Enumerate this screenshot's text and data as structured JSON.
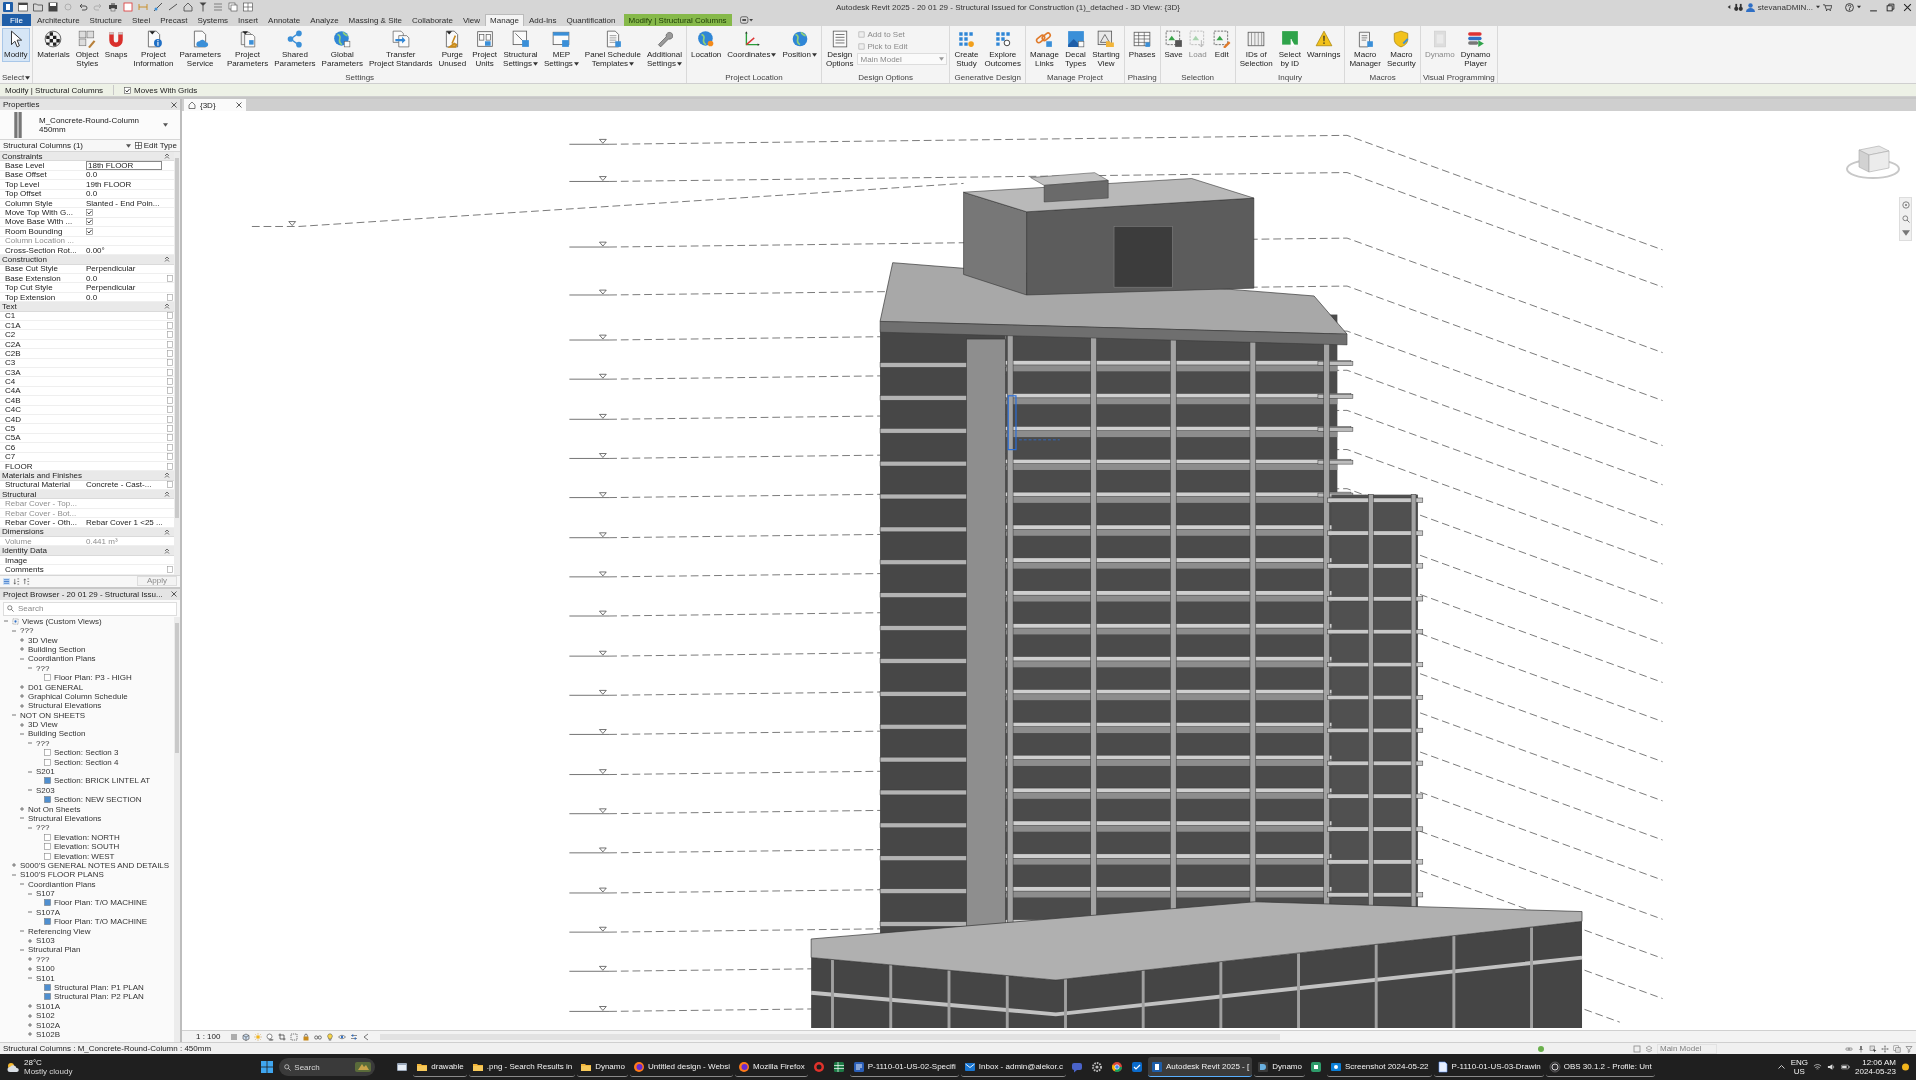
{
  "window": {
    "title": "Autodesk Revit 2025 - 20 01 29 - Structural Issued for Construction (1)_detached - 3D View: {3D}",
    "user": "stevanaDMIN..."
  },
  "ribbon": {
    "tabs": [
      {
        "label": "File",
        "kind": "file",
        "selected": false
      },
      {
        "label": "Architecture",
        "kind": "tab",
        "selected": false
      },
      {
        "label": "Structure",
        "kind": "tab",
        "selected": false
      },
      {
        "label": "Steel",
        "kind": "tab",
        "selected": false
      },
      {
        "label": "Precast",
        "kind": "tab",
        "selected": false
      },
      {
        "label": "Systems",
        "kind": "tab",
        "selected": false
      },
      {
        "label": "Insert",
        "kind": "tab",
        "selected": false
      },
      {
        "label": "Annotate",
        "kind": "tab",
        "selected": false
      },
      {
        "label": "Analyze",
        "kind": "tab",
        "selected": false
      },
      {
        "label": "Massing & Site",
        "kind": "tab",
        "selected": false
      },
      {
        "label": "Collaborate",
        "kind": "tab",
        "selected": false
      },
      {
        "label": "View",
        "kind": "tab",
        "selected": false
      },
      {
        "label": "Manage",
        "kind": "tab",
        "selected": true
      },
      {
        "label": "Add-Ins",
        "kind": "tab",
        "selected": false
      },
      {
        "label": "Quantification",
        "kind": "tab",
        "selected": false
      },
      {
        "label": "Modify | Structural Columns",
        "kind": "contextual",
        "selected": false
      }
    ],
    "panels": [
      {
        "title": "Select",
        "menu": true,
        "items": [
          {
            "kind": "large",
            "lines": [
              "Modify"
            ],
            "selected": true,
            "disabled": false,
            "dropdown": false
          }
        ]
      },
      {
        "title": "Settings",
        "menu": false,
        "items": [
          {
            "kind": "large",
            "lines": [
              "Materials"
            ],
            "selected": false,
            "disabled": false,
            "dropdown": false
          },
          {
            "kind": "large",
            "lines": [
              "Object",
              "Styles"
            ],
            "selected": false,
            "disabled": false,
            "dropdown": false
          },
          {
            "kind": "large",
            "lines": [
              "Snaps"
            ],
            "selected": false,
            "disabled": false,
            "dropdown": false
          },
          {
            "kind": "large",
            "lines": [
              "Project",
              "Information"
            ],
            "selected": false,
            "disabled": false,
            "dropdown": false
          },
          {
            "kind": "large",
            "lines": [
              "Parameters",
              "Service"
            ],
            "selected": false,
            "disabled": false,
            "dropdown": false
          },
          {
            "kind": "large",
            "lines": [
              "Project",
              "Parameters"
            ],
            "selected": false,
            "disabled": false,
            "dropdown": false
          },
          {
            "kind": "large",
            "lines": [
              "Shared",
              "Parameters"
            ],
            "selected": false,
            "disabled": false,
            "dropdown": false
          },
          {
            "kind": "large",
            "lines": [
              "Global",
              "Parameters"
            ],
            "selected": false,
            "disabled": false,
            "dropdown": false
          },
          {
            "kind": "large",
            "lines": [
              "Transfer",
              "Project Standards"
            ],
            "selected": false,
            "disabled": false,
            "dropdown": false
          },
          {
            "kind": "large",
            "lines": [
              "Purge",
              "Unused"
            ],
            "selected": false,
            "disabled": false,
            "dropdown": false
          },
          {
            "kind": "large",
            "lines": [
              "Project",
              "Units"
            ],
            "selected": false,
            "disabled": false,
            "dropdown": false
          },
          {
            "kind": "large",
            "lines": [
              "Structural",
              "Settings"
            ],
            "selected": false,
            "disabled": false,
            "dropdown": true
          },
          {
            "kind": "large",
            "lines": [
              "MEP",
              "Settings"
            ],
            "selected": false,
            "disabled": false,
            "dropdown": true
          },
          {
            "kind": "large",
            "lines": [
              "Panel Schedule",
              "Templates"
            ],
            "selected": false,
            "disabled": false,
            "dropdown": true
          },
          {
            "kind": "large",
            "lines": [
              "Additional",
              "Settings"
            ],
            "selected": false,
            "disabled": false,
            "dropdown": true
          }
        ]
      },
      {
        "title": "Project Location",
        "menu": false,
        "items": [
          {
            "kind": "large",
            "lines": [
              "Location"
            ],
            "selected": false,
            "disabled": false,
            "dropdown": false
          },
          {
            "kind": "large",
            "lines": [
              "Coordinates"
            ],
            "selected": false,
            "disabled": false,
            "dropdown": true
          },
          {
            "kind": "large",
            "lines": [
              "Position"
            ],
            "selected": false,
            "disabled": false,
            "dropdown": true
          }
        ]
      },
      {
        "title": "Design Options",
        "menu": false,
        "items": [
          {
            "kind": "large",
            "lines": [
              "Design",
              "Options"
            ],
            "selected": false,
            "disabled": false,
            "dropdown": false
          },
          {
            "kind": "stack",
            "items": [
              {
                "kind": "button",
                "label": "Add to Set",
                "disabled": true
              },
              {
                "kind": "button",
                "label": "Pick to Edit",
                "disabled": true
              },
              {
                "kind": "combo",
                "label": "Main Model",
                "disabled": true
              }
            ]
          }
        ]
      },
      {
        "title": "Generative Design",
        "menu": false,
        "items": [
          {
            "kind": "large",
            "lines": [
              "Create",
              "Study"
            ],
            "selected": false,
            "disabled": false,
            "dropdown": false
          },
          {
            "kind": "large",
            "lines": [
              "Explore",
              "Outcomes"
            ],
            "selected": false,
            "disabled": false,
            "dropdown": false
          }
        ]
      },
      {
        "title": "Manage Project",
        "menu": false,
        "items": [
          {
            "kind": "large",
            "lines": [
              "Manage",
              "Links"
            ],
            "selected": false,
            "disabled": false,
            "dropdown": false
          },
          {
            "kind": "large",
            "lines": [
              "Decal",
              "Types"
            ],
            "selected": false,
            "disabled": false,
            "dropdown": false
          },
          {
            "kind": "large",
            "lines": [
              "Starting",
              "View"
            ],
            "selected": false,
            "disabled": false,
            "dropdown": false
          }
        ]
      },
      {
        "title": "Phasing",
        "menu": false,
        "items": [
          {
            "kind": "large",
            "lines": [
              "Phases"
            ],
            "selected": false,
            "disabled": false,
            "dropdown": false
          }
        ]
      },
      {
        "title": "Selection",
        "menu": false,
        "items": [
          {
            "kind": "large",
            "lines": [
              "Save"
            ],
            "selected": false,
            "disabled": false,
            "dropdown": false
          },
          {
            "kind": "large",
            "lines": [
              "Load"
            ],
            "selected": false,
            "disabled": true,
            "dropdown": false
          },
          {
            "kind": "large",
            "lines": [
              "Edit"
            ],
            "selected": false,
            "disabled": false,
            "dropdown": false
          }
        ]
      },
      {
        "title": "Inquiry",
        "menu": false,
        "items": [
          {
            "kind": "large",
            "lines": [
              "IDs of",
              "Selection"
            ],
            "selected": false,
            "disabled": false,
            "dropdown": false
          },
          {
            "kind": "large",
            "lines": [
              "Select",
              "by ID"
            ],
            "selected": false,
            "disabled": false,
            "dropdown": false
          },
          {
            "kind": "large",
            "lines": [
              "Warnings"
            ],
            "selected": false,
            "disabled": false,
            "dropdown": false
          }
        ]
      },
      {
        "title": "Macros",
        "menu": false,
        "items": [
          {
            "kind": "large",
            "lines": [
              "Macro",
              "Manager"
            ],
            "selected": false,
            "disabled": false,
            "dropdown": false
          },
          {
            "kind": "large",
            "lines": [
              "Macro",
              "Security"
            ],
            "selected": false,
            "disabled": false,
            "dropdown": false
          }
        ]
      },
      {
        "title": "Visual Programming",
        "menu": false,
        "items": [
          {
            "kind": "large",
            "lines": [
              "Dynamo"
            ],
            "selected": false,
            "disabled": true,
            "dropdown": false
          },
          {
            "kind": "large",
            "lines": [
              "Dynamo",
              "Player"
            ],
            "selected": false,
            "disabled": false,
            "dropdown": false
          }
        ]
      }
    ]
  },
  "options_bar": {
    "context": "Modify | Structural Columns",
    "moves_with_grids": {
      "label": "Moves With Grids",
      "checked": true
    }
  },
  "properties": {
    "title": "Properties",
    "type_name": "M_Concrete-Round-Column 450mm",
    "filter": "Structural Columns (1)",
    "edit_type": "Edit Type",
    "groups": [
      {
        "name": "Constraints",
        "expanded": true,
        "rows": [
          {
            "label": "Base Level",
            "kind": "edit",
            "value": "18th FLOOR",
            "disabled": false,
            "param_button": false
          },
          {
            "label": "Base Offset",
            "kind": "text",
            "value": "0.0",
            "disabled": false,
            "param_button": false
          },
          {
            "label": "Top Level",
            "kind": "text",
            "value": "19th FLOOR",
            "disabled": false,
            "param_button": false
          },
          {
            "label": "Top Offset",
            "kind": "text",
            "value": "0.0",
            "disabled": false,
            "param_button": false
          },
          {
            "label": "Column Style",
            "kind": "text",
            "value": "Slanted - End Poin...",
            "disabled": false,
            "param_button": false
          },
          {
            "label": "Move Top With G...",
            "kind": "check",
            "checked": true,
            "disabled": false,
            "param_button": false
          },
          {
            "label": "Move Base With ...",
            "kind": "check",
            "checked": true,
            "disabled": false,
            "param_button": false
          },
          {
            "label": "Room Bounding",
            "kind": "check",
            "checked": true,
            "disabled": false,
            "param_button": false
          },
          {
            "label": "Column Location ...",
            "kind": "text",
            "disabled": true,
            "param_button": false
          },
          {
            "label": "Cross-Section Rot...",
            "kind": "text",
            "value": "0.00°",
            "disabled": false,
            "param_button": false
          }
        ]
      },
      {
        "name": "Construction",
        "expanded": true,
        "rows": [
          {
            "label": "Base Cut Style",
            "kind": "text",
            "value": "Perpendicular",
            "disabled": false,
            "param_button": false
          },
          {
            "label": "Base Extension",
            "kind": "text",
            "value": "0.0",
            "disabled": false,
            "param_button": true
          },
          {
            "label": "Top Cut Style",
            "kind": "text",
            "value": "Perpendicular",
            "disabled": false,
            "param_button": false
          },
          {
            "label": "Top Extension",
            "kind": "text",
            "value": "0.0",
            "disabled": false,
            "param_button": true
          }
        ]
      },
      {
        "name": "Text",
        "expanded": true,
        "rows": [
          {
            "label": "C1",
            "kind": "text",
            "disabled": false,
            "param_button": true
          },
          {
            "label": "C1A",
            "kind": "text",
            "disabled": false,
            "param_button": true
          },
          {
            "label": "C2",
            "kind": "text",
            "disabled": false,
            "param_button": true
          },
          {
            "label": "C2A",
            "kind": "text",
            "disabled": false,
            "param_button": true
          },
          {
            "label": "C2B",
            "kind": "text",
            "disabled": false,
            "param_button": true
          },
          {
            "label": "C3",
            "kind": "text",
            "disabled": false,
            "param_button": true
          },
          {
            "label": "C3A",
            "kind": "text",
            "disabled": false,
            "param_button": true
          },
          {
            "label": "C4",
            "kind": "text",
            "disabled": false,
            "param_button": true
          },
          {
            "label": "C4A",
            "kind": "text",
            "disabled": false,
            "param_button": true
          },
          {
            "label": "C4B",
            "kind": "text",
            "disabled": false,
            "param_button": true
          },
          {
            "label": "C4C",
            "kind": "text",
            "disabled": false,
            "param_button": true
          },
          {
            "label": "C4D",
            "kind": "text",
            "disabled": false,
            "param_button": true
          },
          {
            "label": "C5",
            "kind": "text",
            "disabled": false,
            "param_button": true
          },
          {
            "label": "C5A",
            "kind": "text",
            "disabled": false,
            "param_button": true
          },
          {
            "label": "C6",
            "kind": "text",
            "disabled": false,
            "param_button": true
          },
          {
            "label": "C7",
            "kind": "text",
            "disabled": false,
            "param_button": true
          },
          {
            "label": "FLOOR",
            "kind": "text",
            "disabled": false,
            "param_button": true
          }
        ]
      },
      {
        "name": "Materials and Finishes",
        "expanded": true,
        "rows": [
          {
            "label": "Structural Material",
            "kind": "text",
            "value": "Concrete - Cast-...",
            "disabled": false,
            "param_button": true
          }
        ]
      },
      {
        "name": "Structural",
        "expanded": true,
        "rows": [
          {
            "label": "Rebar Cover - Top...",
            "kind": "text",
            "disabled": true,
            "param_button": false
          },
          {
            "label": "Rebar Cover - Bot...",
            "kind": "text",
            "disabled": true,
            "param_button": false
          },
          {
            "label": "Rebar Cover - Oth...",
            "kind": "text",
            "value": "Rebar Cover 1 <25 ...",
            "disabled": false,
            "param_button": false
          }
        ]
      },
      {
        "name": "Dimensions",
        "expanded": true,
        "rows": [
          {
            "label": "Volume",
            "kind": "text",
            "value": "0.441 m³",
            "disabled": true,
            "param_button": false
          }
        ]
      },
      {
        "name": "Identity Data",
        "expanded": true,
        "rows": [
          {
            "label": "Image",
            "kind": "text",
            "disabled": false,
            "param_button": false
          },
          {
            "label": "Comments",
            "kind": "text",
            "disabled": false,
            "param_button": true
          }
        ]
      }
    ],
    "apply": {
      "label": "Apply",
      "disabled": true
    }
  },
  "project_browser": {
    "title": "Project Browser - 20 01 29 - Structural Issu...",
    "search": {
      "placeholder": "Search"
    },
    "tree": [
      {
        "label": "Views (Custom Views)",
        "kind": "root",
        "expanded": true,
        "children": [
          {
            "label": "???",
            "kind": "group",
            "expanded": true,
            "children": [
              {
                "label": "3D View",
                "kind": "group",
                "expanded": false
              },
              {
                "label": "Building Section",
                "kind": "group",
                "expanded": false
              },
              {
                "label": "Coordiantion Plans",
                "kind": "group",
                "expanded": true,
                "children": [
                  {
                    "label": "???",
                    "kind": "group",
                    "expanded": true,
                    "children": [
                      {
                        "label": "Floor Plan: P3 - HIGH",
                        "kind": "view",
                        "filled": false
                      }
                    ]
                  }
                ]
              },
              {
                "label": "D01 GENERAL",
                "kind": "group",
                "expanded": false
              },
              {
                "label": "Graphical Column Schedule",
                "kind": "group",
                "expanded": false
              },
              {
                "label": "Structural Elevations",
                "kind": "group",
                "expanded": false
              }
            ]
          },
          {
            "label": "NOT ON SHEETS",
            "kind": "group",
            "expanded": true,
            "children": [
              {
                "label": "3D View",
                "kind": "group",
                "expanded": false
              },
              {
                "label": "Building Section",
                "kind": "group",
                "expanded": true,
                "children": [
                  {
                    "label": "???",
                    "kind": "group",
                    "expanded": true,
                    "children": [
                      {
                        "label": "Section: Section 3",
                        "kind": "view",
                        "filled": false
                      },
                      {
                        "label": "Section: Section 4",
                        "kind": "view",
                        "filled": false
                      }
                    ]
                  },
                  {
                    "label": "S201",
                    "kind": "group",
                    "expanded": true,
                    "children": [
                      {
                        "label": "Section: BRICK LINTEL AT",
                        "kind": "view",
                        "filled": true
                      }
                    ]
                  },
                  {
                    "label": "S203",
                    "kind": "group",
                    "expanded": true,
                    "children": [
                      {
                        "label": "Section: NEW SECTION",
                        "kind": "view",
                        "filled": true
                      }
                    ]
                  }
                ]
              },
              {
                "label": "Not On Sheets",
                "kind": "group",
                "expanded": false
              },
              {
                "label": "Structural Elevations",
                "kind": "group",
                "expanded": true,
                "children": [
                  {
                    "label": "???",
                    "kind": "group",
                    "expanded": true,
                    "children": [
                      {
                        "label": "Elevation: NORTH",
                        "kind": "view",
                        "filled": false
                      },
                      {
                        "label": "Elevation: SOUTH",
                        "kind": "view",
                        "filled": false
                      },
                      {
                        "label": "Elevation: WEST",
                        "kind": "view",
                        "filled": false
                      }
                    ]
                  }
                ]
              }
            ]
          },
          {
            "label": "S000'S GENERAL NOTES AND DETAILS",
            "kind": "group",
            "expanded": false
          },
          {
            "label": "S100'S FLOOR PLANS",
            "kind": "group",
            "expanded": true,
            "children": [
              {
                "label": "Coordiantion Plans",
                "kind": "group",
                "expanded": true,
                "children": [
                  {
                    "label": "S107",
                    "kind": "group",
                    "expanded": true,
                    "children": [
                      {
                        "label": "Floor Plan: T/O MACHINE",
                        "kind": "view",
                        "filled": true
                      }
                    ]
                  },
                  {
                    "label": "S107A",
                    "kind": "group",
                    "expanded": true,
                    "children": [
                      {
                        "label": "Floor Plan: T/O MACHINE",
                        "kind": "view",
                        "filled": true
                      }
                    ]
                  }
                ]
              },
              {
                "label": "Referencing View",
                "kind": "group",
                "expanded": true,
                "children": [
                  {
                    "label": "S103",
                    "kind": "group",
                    "expanded": false
                  }
                ]
              },
              {
                "label": "Structural Plan",
                "kind": "group",
                "expanded": true,
                "children": [
                  {
                    "label": "???",
                    "kind": "group",
                    "expanded": false
                  },
                  {
                    "label": "S100",
                    "kind": "group",
                    "expanded": false
                  },
                  {
                    "label": "S101",
                    "kind": "group",
                    "expanded": true,
                    "children": [
                      {
                        "label": "Structural Plan: P1 PLAN",
                        "kind": "view",
                        "filled": true
                      },
                      {
                        "label": "Structural Plan: P2 PLAN",
                        "kind": "view",
                        "filled": true
                      }
                    ]
                  },
                  {
                    "label": "S101A",
                    "kind": "group",
                    "expanded": false
                  },
                  {
                    "label": "S102",
                    "kind": "group",
                    "expanded": false
                  },
                  {
                    "label": "S102A",
                    "kind": "group",
                    "expanded": false
                  },
                  {
                    "label": "S102B",
                    "kind": "group",
                    "expanded": false
                  }
                ]
              }
            ]
          }
        ]
      }
    ]
  },
  "view": {
    "tab": "{3D}",
    "scale": "1 : 100"
  },
  "status_bar": {
    "text": "Structural Columns : M_Concrete-Round-Column : 450mm",
    "model": {
      "label": "Main Model",
      "disabled": true
    }
  },
  "taskbar": {
    "weather": {
      "temperature": "28°C",
      "condition": "Mostly cloudy"
    },
    "search": {
      "placeholder": "Search"
    },
    "apps": [
      {
        "selected": false
      },
      {
        "label": "drawable",
        "selected": false
      },
      {
        "label": ".png - Search Results in",
        "selected": false
      },
      {
        "label": "Dynamo",
        "selected": false
      },
      {
        "label": "Untitled design - Websi",
        "selected": false
      },
      {
        "label": "Mozilla Firefox",
        "selected": false
      },
      {
        "selected": false
      },
      {
        "selected": false
      },
      {
        "label": "P-1110-01-US-02-Specifi",
        "selected": false
      },
      {
        "label": "Inbox - admin@alekor.c",
        "selected": false
      },
      {
        "selected": false
      },
      {
        "selected": false
      },
      {
        "selected": false
      },
      {
        "selected": false
      },
      {
        "label": "Autodesk Revit 2025 - [",
        "selected": true
      },
      {
        "label": "Dynamo",
        "selected": false
      },
      {
        "selected": false
      },
      {
        "label": "Screenshot 2024-05-22",
        "selected": false
      },
      {
        "label": "P-1110-01-US-03-Drawin",
        "selected": false
      },
      {
        "label": "OBS 30.1.2 - Profile: Unt",
        "selected": false
      }
    ],
    "tray": {
      "language": "ENG",
      "region": "US",
      "time": "12:06 AM",
      "date": "2024-05-23"
    }
  }
}
